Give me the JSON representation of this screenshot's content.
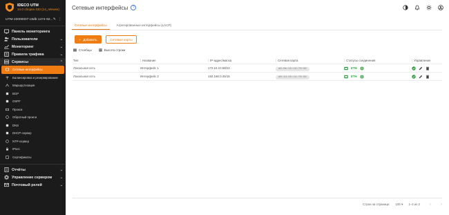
{
  "brand": {
    "name": "IDECO UTM",
    "version": "14.0 сборка 433 (14_release)"
  },
  "device": {
    "name": "UTM-23000007-c8db-1474-82..."
  },
  "sidebar": {
    "top_items": [
      {
        "label": "Панель мониторинга",
        "icon": "dashboard-icon"
      },
      {
        "label": "Пользователи",
        "icon": "users-icon"
      },
      {
        "label": "Мониторинг",
        "icon": "monitoring-icon"
      },
      {
        "label": "Правила трафика",
        "icon": "traffic-rules-icon"
      },
      {
        "label": "Сервисы",
        "icon": "services-icon"
      }
    ],
    "sub_items": [
      "Сетевые интерфейсы",
      "Балансировка и резервирование",
      "Маршрутизация",
      "BGP",
      "OSPF",
      "Прокси",
      "Обратный прокси",
      "DNS",
      "DHCP-сервер",
      "NTP-сервер",
      "IPsec",
      "Сертификаты"
    ],
    "bottom_items": [
      {
        "label": "Отчёты",
        "icon": "reports-icon"
      },
      {
        "label": "Управление сервером",
        "icon": "server-management-icon"
      },
      {
        "label": "Почтовый релей",
        "icon": "mail-relay-icon"
      }
    ]
  },
  "header": {
    "title": "Сетевые интерфейсы"
  },
  "tabs": [
    "Сетевые интерфейсы",
    "Агрегированные интерфейсы (LACP)"
  ],
  "buttons": {
    "add": "Добавить",
    "cards": "Сетевые карты"
  },
  "table_tools": {
    "columns": "Столбцы",
    "row_height": "Высота строки"
  },
  "table": {
    "headers": [
      "Тип",
      "Название",
      "IP-адрес/маска",
      "Сетевая карта",
      "Статусы соединения",
      "Управление"
    ],
    "rows": [
      {
        "type": "Локальная сеть",
        "name": "Интерфейс 1",
        "ip": "172.16.10.58/24",
        "mac": "d0:0e:15:14:70:02",
        "status": "ETH"
      },
      {
        "type": "Локальная сеть",
        "name": "Интерфейс 2",
        "ip": "192.168.0.45/16",
        "mac": "d0:14:15:14:70:02",
        "status": "ETH"
      }
    ]
  },
  "pagination": {
    "rows_label": "Строк на странице:",
    "rows_value": "100",
    "range": "1–2 из 2"
  },
  "colors": {
    "accent": "#ef7d13",
    "sidebar_bg": "#1b1b1b",
    "eth_green": "#2c9c3c"
  }
}
